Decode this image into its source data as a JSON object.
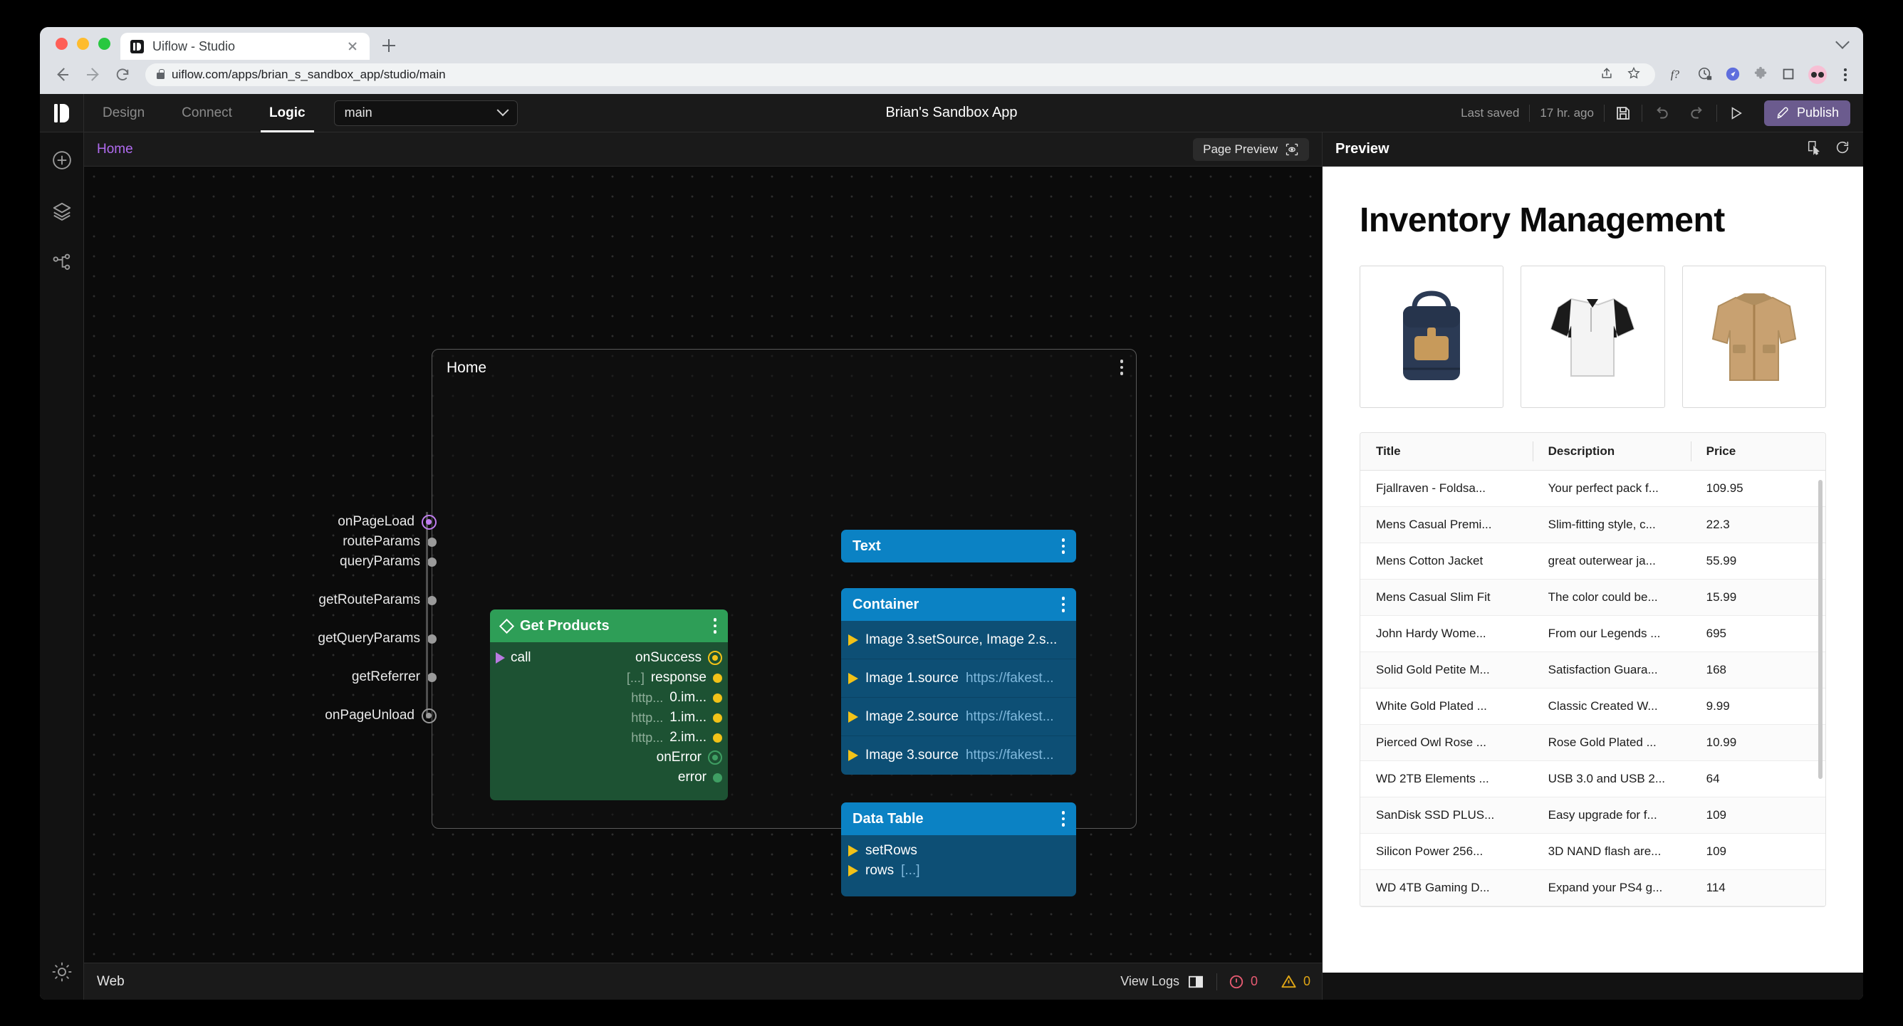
{
  "browser": {
    "tab_title": "Uiflow - Studio",
    "url": "uiflow.com/apps/brian_s_sandbox_app/studio/main",
    "new_tab_label": "+",
    "icons": [
      "share-icon",
      "bookmark-star-icon",
      "f-question-icon",
      "clock-lock-icon",
      "compass-icon",
      "puzzle-extension-icon",
      "square-icon",
      "glasses-avatar-icon",
      "browser-menu-icon"
    ]
  },
  "topbar": {
    "tabs": [
      {
        "label": "Design",
        "active": false
      },
      {
        "label": "Connect",
        "active": false
      },
      {
        "label": "Logic",
        "active": true
      }
    ],
    "page_select": "main",
    "app_title": "Brian's Sandbox App",
    "last_saved_label": "Last saved",
    "last_saved_time": "17 hr. ago",
    "publish_label": "Publish"
  },
  "left_rail": {
    "items": [
      "add-icon",
      "layers-icon",
      "node-graph-icon",
      "theme-toggle-icon"
    ]
  },
  "canvas_header": {
    "breadcrumb": "Home",
    "page_preview_label": "Page Preview"
  },
  "canvas_footer": {
    "platform": "Web",
    "view_logs_label": "View Logs",
    "error_count": "0",
    "warning_count": "0"
  },
  "graph": {
    "group_title": "Home",
    "page_ports": [
      {
        "label": "onPageLoad",
        "type": "event-active",
        "gap": false
      },
      {
        "label": "routeParams",
        "type": "data",
        "gap": false
      },
      {
        "label": "queryParams",
        "type": "data",
        "gap": false
      },
      {
        "label": "getRouteParams",
        "type": "data",
        "gap": true
      },
      {
        "label": "getQueryParams",
        "type": "data",
        "gap": true
      },
      {
        "label": "getReferrer",
        "type": "data",
        "gap": true
      },
      {
        "label": "onPageUnload",
        "type": "event",
        "gap": true
      }
    ],
    "function_node": {
      "title": "Get Products",
      "input_label": "call",
      "outputs": [
        {
          "label": "onSuccess",
          "prefix": "",
          "pin": "ring-y"
        },
        {
          "label": "response",
          "prefix": "[...]",
          "pin": "dot-y"
        },
        {
          "label": "0.im...",
          "prefix": "http...",
          "pin": "dot-y"
        },
        {
          "label": "1.im...",
          "prefix": "http...",
          "pin": "dot-y"
        },
        {
          "label": "2.im...",
          "prefix": "http...",
          "pin": "dot-y"
        },
        {
          "label": "onError",
          "prefix": "",
          "pin": "ring-g"
        },
        {
          "label": "error",
          "prefix": "",
          "pin": "dot-g"
        }
      ]
    },
    "text_node": {
      "title": "Text"
    },
    "container_node": {
      "title": "Container",
      "rows": [
        {
          "label": "Image 3.setSource, Image 2.s...",
          "value": ""
        },
        {
          "label": "Image 1.source",
          "value": "https://fakest..."
        },
        {
          "label": "Image 2.source",
          "value": "https://fakest..."
        },
        {
          "label": "Image 3.source",
          "value": "https://fakest..."
        }
      ]
    },
    "datatable_node": {
      "title": "Data Table",
      "rows": [
        {
          "label": "setRows",
          "value": ""
        },
        {
          "label": "rows",
          "value": "[...]"
        }
      ]
    }
  },
  "preview": {
    "panel_title": "Preview",
    "actions": [
      "select-pointer-icon",
      "refresh-icon"
    ],
    "page_title": "Inventory Management",
    "images": [
      "backpack-image",
      "tshirt-image",
      "jacket-image"
    ],
    "table": {
      "columns": [
        "Title",
        "Description",
        "Price"
      ],
      "rows": [
        [
          "Fjallraven - Foldsa...",
          "Your perfect pack f...",
          "109.95"
        ],
        [
          "Mens Casual Premi...",
          "Slim-fitting style, c...",
          "22.3"
        ],
        [
          "Mens Cotton Jacket",
          "great outerwear ja...",
          "55.99"
        ],
        [
          "Mens Casual Slim Fit",
          "The color could be...",
          "15.99"
        ],
        [
          "John Hardy Wome...",
          "From our Legends ...",
          "695"
        ],
        [
          "Solid Gold Petite M...",
          "Satisfaction Guara...",
          "168"
        ],
        [
          "White Gold Plated ...",
          "Classic Created W...",
          "9.99"
        ],
        [
          "Pierced Owl Rose ...",
          "Rose Gold Plated ...",
          "10.99"
        ],
        [
          "WD 2TB Elements ...",
          "USB 3.0 and USB 2...",
          "64"
        ],
        [
          "SanDisk SSD PLUS...",
          "Easy upgrade for f...",
          "109"
        ],
        [
          "Silicon Power 256...",
          "3D NAND flash are...",
          "109"
        ],
        [
          "WD 4TB Gaming D...",
          "Expand your PS4 g...",
          "114"
        ]
      ]
    }
  },
  "colors": {
    "accent_purple": "#b06bf0",
    "publish_purple": "#6b5b8e",
    "node_green": "#2e9e57",
    "node_blue": "#0b82c4",
    "wire_yellow": "#f2c218",
    "error_red": "#e85b72",
    "warning_yellow": "#e0a615"
  }
}
